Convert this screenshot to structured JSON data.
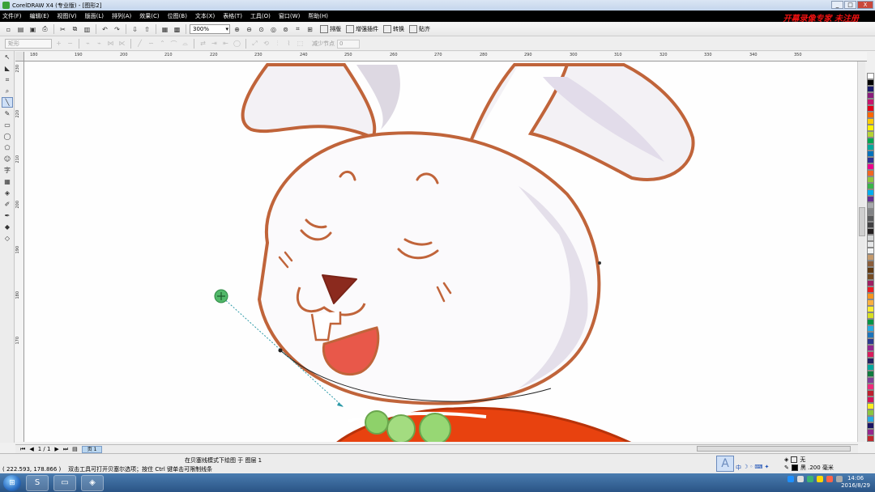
{
  "window": {
    "title": "CorelDRAW X4 (专业版) - [图形2]",
    "minimize": "_",
    "maximize": "□",
    "close": "X"
  },
  "menu": [
    "文件(F)",
    "编辑(E)",
    "视图(V)",
    "版面(L)",
    "排列(A)",
    "效果(C)",
    "位图(B)",
    "文本(X)",
    "表格(T)",
    "工具(O)",
    "窗口(W)",
    "帮助(H)"
  ],
  "watermark": "开幕录像专家 未注册",
  "toolbar": {
    "zoom": "300%",
    "buttons": [
      "new-icon",
      "open-icon",
      "save-icon",
      "print-icon",
      "cut-icon",
      "copy-icon",
      "paste-icon",
      "undo-icon",
      "redo-icon",
      "import-icon",
      "export-icon",
      "app-launcher-icon",
      "welcome-icon"
    ],
    "text_buttons": [
      {
        "icon": "sort-icon",
        "label": "排版"
      },
      {
        "icon": "sort-icon",
        "label": "增强插件"
      },
      {
        "icon": "sort-icon",
        "label": "转换"
      },
      {
        "icon": "snap-icon",
        "label": "贴齐"
      }
    ]
  },
  "property_bar": {
    "preset": "矩形",
    "node_label": "减少节点",
    "node_value": "0"
  },
  "rulers": {
    "top": [
      "180",
      "190",
      "200",
      "210",
      "220",
      "230",
      "240",
      "250",
      "260",
      "270",
      "280",
      "290",
      "300",
      "310",
      "320",
      "330",
      "340",
      "350"
    ],
    "left": [
      "230",
      "220",
      "210",
      "200",
      "190",
      "180",
      "170"
    ]
  },
  "pagebar": {
    "page_count": "1 / 1",
    "tab": "页 1"
  },
  "status": {
    "mode_text": "在贝塞线模式下绘图 于 图层 1",
    "coords": "( 222.593, 178.866 )",
    "hint": "双击工具可打开贝塞尔选项；按住 Ctrl 键单击可限制线条",
    "fill_none": "无",
    "outline": "黑 .200 毫米"
  },
  "taskbar": {
    "time": "14:06",
    "date": "2016/8/29"
  },
  "palette": [
    "#ffffff",
    "#000000",
    "#1c1c6b",
    "#8a1c7c",
    "#c6166e",
    "#e2001a",
    "#ff6600",
    "#ffcc00",
    "#fff200",
    "#b5d334",
    "#00a651",
    "#00a99d",
    "#0072bc",
    "#2e3192",
    "#ec008c",
    "#f26522",
    "#8dc63f",
    "#39b54a",
    "#00aeef",
    "#662d91",
    "#a7a9ac",
    "#808285",
    "#58595b",
    "#414042",
    "#231f20",
    "#d1d3d4",
    "#e6e7e8",
    "#f1f2f2",
    "#c49a6c",
    "#8b5e3c",
    "#603913",
    "#754c24",
    "#9e1f63",
    "#ed1c24",
    "#f7941d",
    "#fbb040",
    "#f9ed32",
    "#d7df23",
    "#009444",
    "#27aae1",
    "#1c75bc",
    "#2b3990",
    "#92278f",
    "#da1c5c",
    "#262262",
    "#00a79d",
    "#0f7c3f",
    "#7f3f98",
    "#ee2a7b",
    "#be1e2d",
    "#d4145a",
    "#fcee21",
    "#8cc63f",
    "#29abe2",
    "#1b1464",
    "#93278f",
    "#c1272d"
  ]
}
